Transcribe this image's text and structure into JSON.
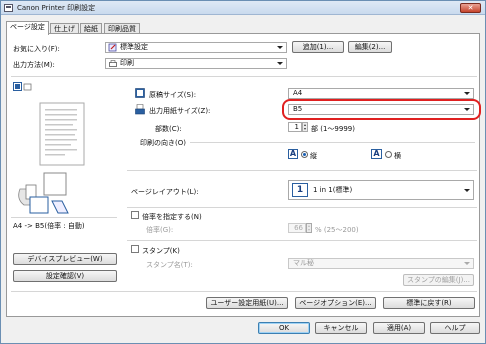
{
  "window": {
    "title": "Canon Printer 印刷設定",
    "close_label": "✕"
  },
  "tabs": [
    {
      "label": "ページ設定"
    },
    {
      "label": "仕上げ"
    },
    {
      "label": "給紙"
    },
    {
      "label": "印刷品質"
    }
  ],
  "favorites": {
    "label": "お気に入り(F):",
    "value": "標準設定",
    "add_label": "追加(1)...",
    "edit_label": "編集(2)..."
  },
  "output_method": {
    "label": "出力方法(M):",
    "value": "印刷"
  },
  "preview": {
    "caption": "A4 -> B5(倍率 : 自動)",
    "device_preview_label": "デバイスプレビュー(W)",
    "confirm_settings_label": "設定確認(V)"
  },
  "original_size": {
    "label": "原稿サイズ(S):",
    "value": "A4"
  },
  "output_paper_size": {
    "label": "出力用紙サイズ(Z):",
    "value": "B5"
  },
  "copies": {
    "label": "部数(C):",
    "value": "1",
    "unit": "部 (1〜9999)"
  },
  "orientation": {
    "label": "印刷の向き(O)",
    "portrait_label": "縦",
    "landscape_label": "横",
    "portrait_letter": "A",
    "landscape_letter": "A",
    "selected": "portrait"
  },
  "page_layout": {
    "label": "ページレイアウト(L):",
    "number": "1",
    "value": "1 in 1(標準)"
  },
  "scaling": {
    "checkbox_label": "倍率を指定する(N)",
    "rate_label": "倍率(G):",
    "rate_value": "66",
    "rate_unit": "% (25〜200)"
  },
  "stamp": {
    "checkbox_label": "スタンプ(K)",
    "name_label": "スタンプ名(T):",
    "name_value": "マル秘",
    "edit_label": "スタンプの編集(J)..."
  },
  "panel_buttons": {
    "user_paper_label": "ユーザー設定用紙(U)...",
    "page_options_label": "ページオプション(E)...",
    "restore_defaults_label": "標準に戻す(R)"
  },
  "footer": {
    "ok_label": "OK",
    "cancel_label": "キャンセル",
    "apply_label": "適用(A)",
    "help_label": "ヘルプ"
  }
}
